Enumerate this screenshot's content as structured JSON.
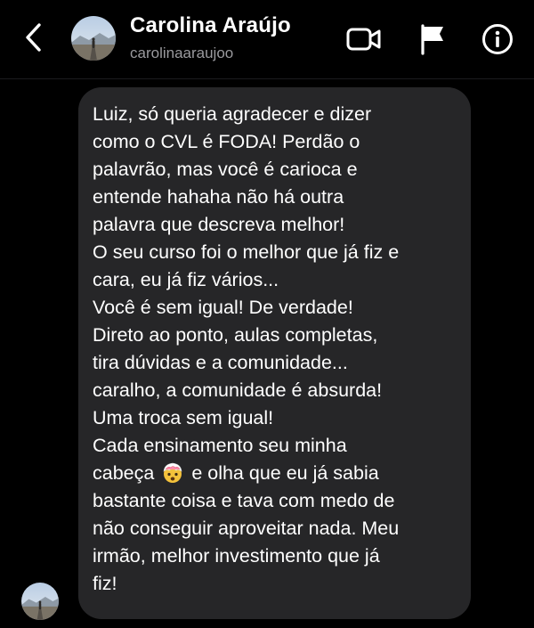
{
  "header": {
    "contact_name": "Carolina Araújo",
    "contact_handle": "carolinaaraujoo",
    "back_icon": "chevron-left-icon",
    "video_icon": "video-camera-icon",
    "flag_icon": "flag-icon",
    "info_icon": "info-icon"
  },
  "message": {
    "direction": "incoming",
    "lines": [
      "Luiz, só queria agradecer e dizer",
      "como o CVL é FODA! Perdão o",
      "palavrão, mas você é carioca e",
      "entende hahaha não há outra",
      "palavra que descreva melhor!",
      "O seu curso foi o melhor que já fiz e",
      "cara, eu já fiz vários...",
      "Você é sem igual! De verdade!",
      "Direto ao ponto, aulas completas,",
      "tira dúvidas e a comunidade...",
      "caralho, a comunidade é absurda!",
      "Uma troca sem igual!",
      "Cada ensinamento seu minha"
    ],
    "emoji_line_before": "cabeça",
    "emoji_line_after": "e olha que eu já sabia",
    "emoji_icon": "exploding-head-emoji",
    "lines_after_emoji": [
      "bastante coisa e tava com medo de",
      "não conseguir aproveitar nada. Meu",
      "irmão, melhor investimento que já",
      "fiz!"
    ]
  },
  "colors": {
    "background": "#000000",
    "bubble": "#262628",
    "secondary_text": "#9a9a9e"
  }
}
